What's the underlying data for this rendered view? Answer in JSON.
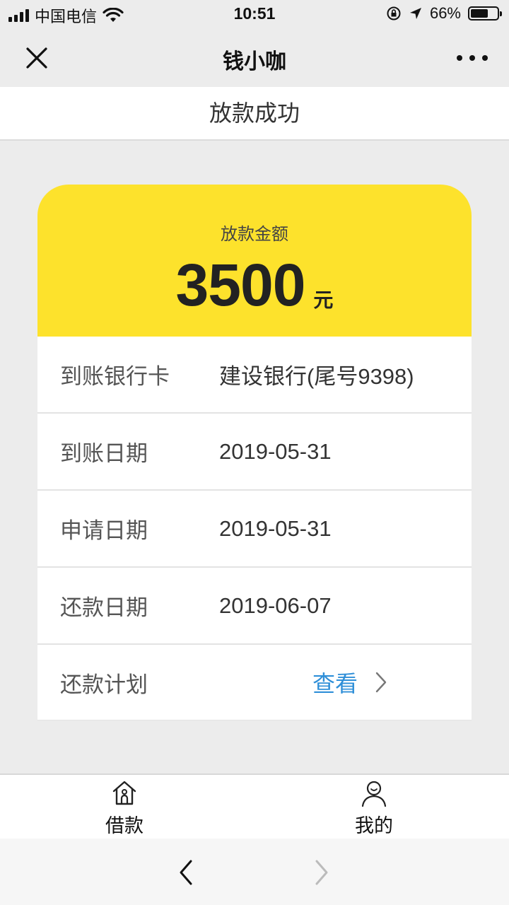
{
  "status_bar": {
    "carrier": "中国电信",
    "time": "10:51",
    "battery_percent": "66%",
    "battery_level": 0.66
  },
  "nav": {
    "title": "钱小咖"
  },
  "page": {
    "title": "放款成功"
  },
  "card": {
    "amount_label": "放款金额",
    "amount": "3500",
    "unit": "元",
    "accent_color": "#fde22c",
    "rows": [
      {
        "label": "到账银行卡",
        "value": "建设银行(尾号9398)"
      },
      {
        "label": "到账日期",
        "value": "2019-05-31"
      },
      {
        "label": "申请日期",
        "value": "2019-05-31"
      },
      {
        "label": "还款日期",
        "value": "2019-06-07"
      },
      {
        "label": "还款计划",
        "link": "查看"
      }
    ],
    "link_color": "#2f8fd8"
  },
  "tabs": [
    {
      "label": "借款",
      "icon": "home-icon"
    },
    {
      "label": "我的",
      "icon": "user-icon"
    }
  ],
  "browser": {
    "back_icon": "chevron-left-icon",
    "forward_icon": "chevron-right-icon"
  }
}
